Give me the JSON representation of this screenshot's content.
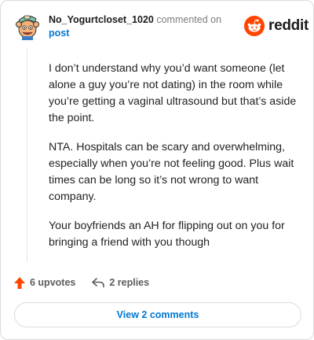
{
  "comment": {
    "author": "No_Yogurtcloset_1020",
    "action": "commented on",
    "target": "post",
    "paragraphs": [
      "I don’t understand why you’d want someone (let alone a guy you’re not dating) in the room while you’re getting a vaginal ultrasound but that’s aside the point.",
      "NTA. Hospitals can be scary and overwhelming, especially when you’re not feeling good. Plus wait times can be long so it’s not wrong to want company.",
      "Your boyfriends an AH for flipping out on you for bringing a friend with you though"
    ]
  },
  "brand": {
    "name": "reddit",
    "logo_icon": "reddit-snoo-icon",
    "color": "#ff4500"
  },
  "footer": {
    "upvotes": "6 upvotes",
    "upvote_icon": "upvote-arrow-icon",
    "replies": "2 replies",
    "reply_icon": "reply-arrow-icon"
  },
  "view_button": {
    "label": "View 2 comments"
  },
  "colors": {
    "link": "#0079d3",
    "upvote": "#ff4500",
    "muted": "#7c7c7c"
  }
}
